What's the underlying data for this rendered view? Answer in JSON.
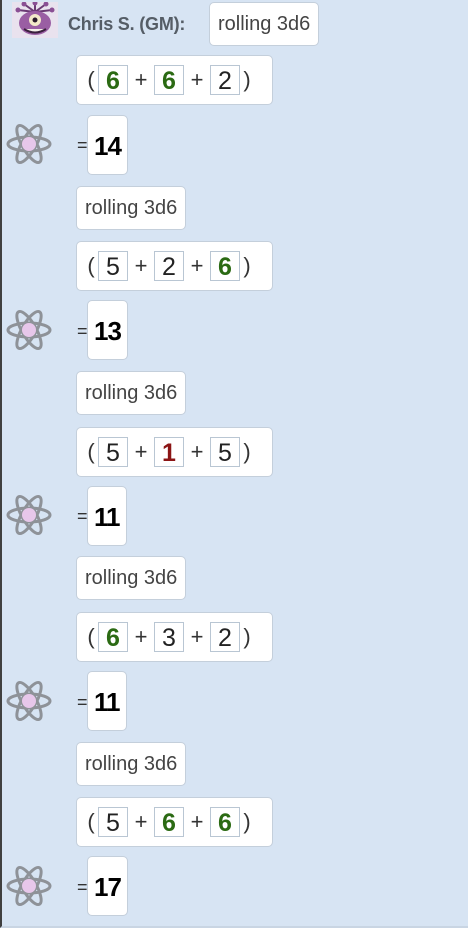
{
  "sender": {
    "name": "Chris S. (GM):",
    "avatar_icon": "beholder-avatar"
  },
  "result_icon": "atom-icon",
  "rolls": [
    {
      "command": "rolling 3d6",
      "dice": [
        {
          "value": "6",
          "kind": "max"
        },
        {
          "value": "6",
          "kind": "max"
        },
        {
          "value": "2",
          "kind": "normal"
        }
      ],
      "equals": "=",
      "total": "14"
    },
    {
      "command": "rolling 3d6",
      "dice": [
        {
          "value": "5",
          "kind": "normal"
        },
        {
          "value": "2",
          "kind": "normal"
        },
        {
          "value": "6",
          "kind": "max"
        }
      ],
      "equals": "=",
      "total": "13"
    },
    {
      "command": "rolling 3d6",
      "dice": [
        {
          "value": "5",
          "kind": "normal"
        },
        {
          "value": "1",
          "kind": "min"
        },
        {
          "value": "5",
          "kind": "normal"
        }
      ],
      "equals": "=",
      "total": "11"
    },
    {
      "command": "rolling 3d6",
      "dice": [
        {
          "value": "6",
          "kind": "max"
        },
        {
          "value": "3",
          "kind": "normal"
        },
        {
          "value": "2",
          "kind": "normal"
        }
      ],
      "equals": "=",
      "total": "11"
    },
    {
      "command": "rolling 3d6",
      "dice": [
        {
          "value": "5",
          "kind": "normal"
        },
        {
          "value": "6",
          "kind": "max"
        },
        {
          "value": "6",
          "kind": "max"
        }
      ],
      "equals": "=",
      "total": "17"
    }
  ],
  "symbols": {
    "open_paren": "(",
    "close_paren": ")",
    "plus": "+"
  },
  "colors": {
    "background": "#d7e4f3",
    "max_die": "#2b6a13",
    "min_die": "#8b1414"
  }
}
